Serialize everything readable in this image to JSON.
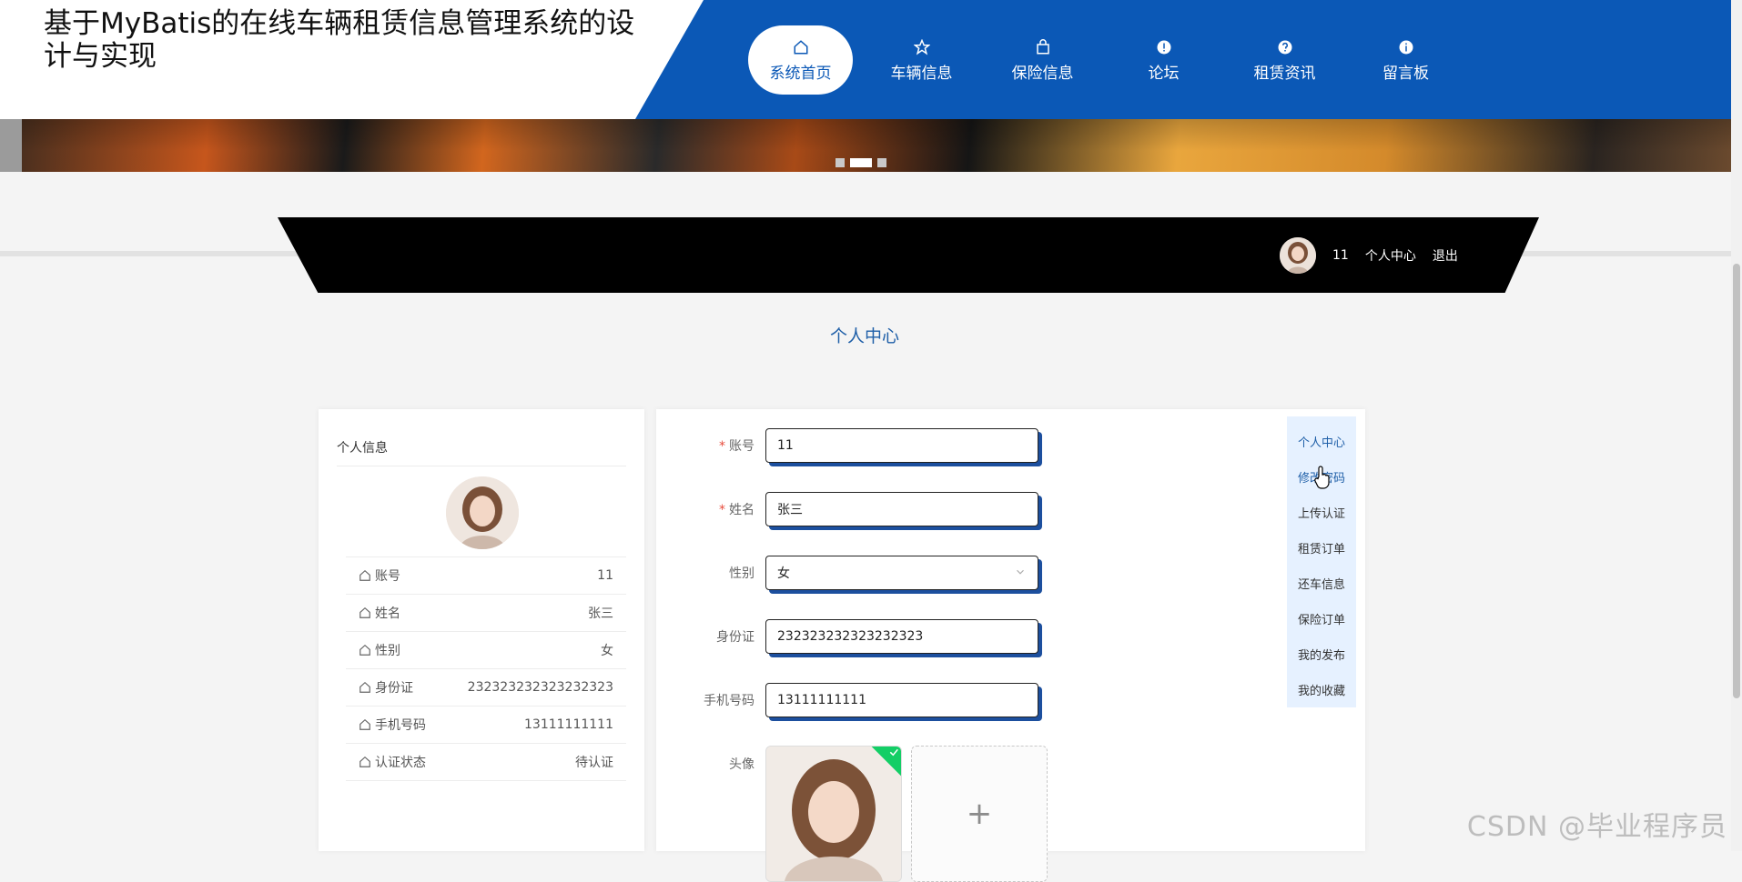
{
  "header": {
    "title": "基于MyBatis的在线车辆租赁信息管理系统的设计与实现",
    "nav": [
      {
        "label": "系统首页",
        "icon": "home-icon",
        "active": true
      },
      {
        "label": "车辆信息",
        "icon": "star-icon"
      },
      {
        "label": "保险信息",
        "icon": "bag-icon"
      },
      {
        "label": "论坛",
        "icon": "info-icon"
      },
      {
        "label": "租赁资讯",
        "icon": "help-icon"
      },
      {
        "label": "留言板",
        "icon": "info-icon"
      }
    ]
  },
  "banner": {
    "slides": 3,
    "active_slide": 2
  },
  "userbar": {
    "username": "11",
    "center_link": "个人中心",
    "logout_link": "退出"
  },
  "page": {
    "title": "个人中心"
  },
  "profile_card": {
    "title": "个人信息",
    "rows": [
      {
        "label": "账号",
        "value": "11"
      },
      {
        "label": "姓名",
        "value": "张三"
      },
      {
        "label": "性别",
        "value": "女"
      },
      {
        "label": "身份证",
        "value": "232323232323232323"
      },
      {
        "label": "手机号码",
        "value": "13111111111"
      },
      {
        "label": "认证状态",
        "value": "待认证"
      }
    ]
  },
  "form": {
    "account": {
      "label": "账号",
      "value": "11",
      "required": true
    },
    "name": {
      "label": "姓名",
      "value": "张三",
      "required": true
    },
    "gender": {
      "label": "性别",
      "value": "女"
    },
    "id_card": {
      "label": "身份证",
      "value": "232323232323232323"
    },
    "phone": {
      "label": "手机号码",
      "value": "13111111111"
    },
    "avatar": {
      "label": "头像",
      "add_symbol": "+"
    }
  },
  "side_menu": [
    {
      "label": "个人中心",
      "active": true
    },
    {
      "label": "修改密码",
      "hover": true
    },
    {
      "label": "上传认证"
    },
    {
      "label": "租赁订单"
    },
    {
      "label": "还车信息"
    },
    {
      "label": "保险订单"
    },
    {
      "label": "我的发布"
    },
    {
      "label": "我的收藏"
    }
  ],
  "colors": {
    "brand": "#0b58b6",
    "accent_text": "#1f5fa8",
    "required": "#e74c3c",
    "success": "#13ce66"
  },
  "watermark": "CSDN @毕业程序员"
}
